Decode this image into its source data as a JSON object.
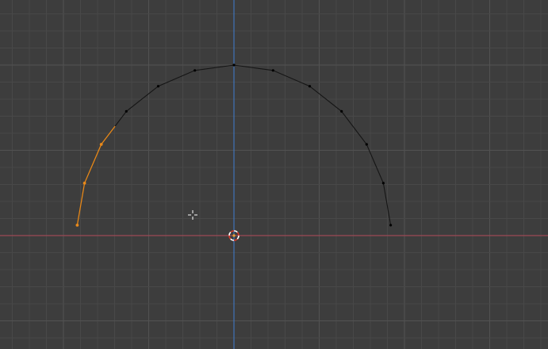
{
  "viewport": {
    "background_color": "#3d3d3d",
    "grid_minor_color": "#484848",
    "grid_major_color": "#525252",
    "x_axis_color": "#9b4a55",
    "y_axis_color": "#3f73b8"
  },
  "curve": {
    "edge_color": "#151515",
    "vertex_color": "#000000",
    "selected_color": "#e8891a",
    "vertex_count": 13,
    "selected_vertices": [
      0,
      1,
      2
    ]
  },
  "cursor_icon": "crosshair-cursor-icon",
  "origin_icon": "3d-cursor-icon",
  "cursor_colors": {
    "ring_outer": "#ffffff",
    "ring_inner": "#d63a2a",
    "center": "#f0a030"
  }
}
